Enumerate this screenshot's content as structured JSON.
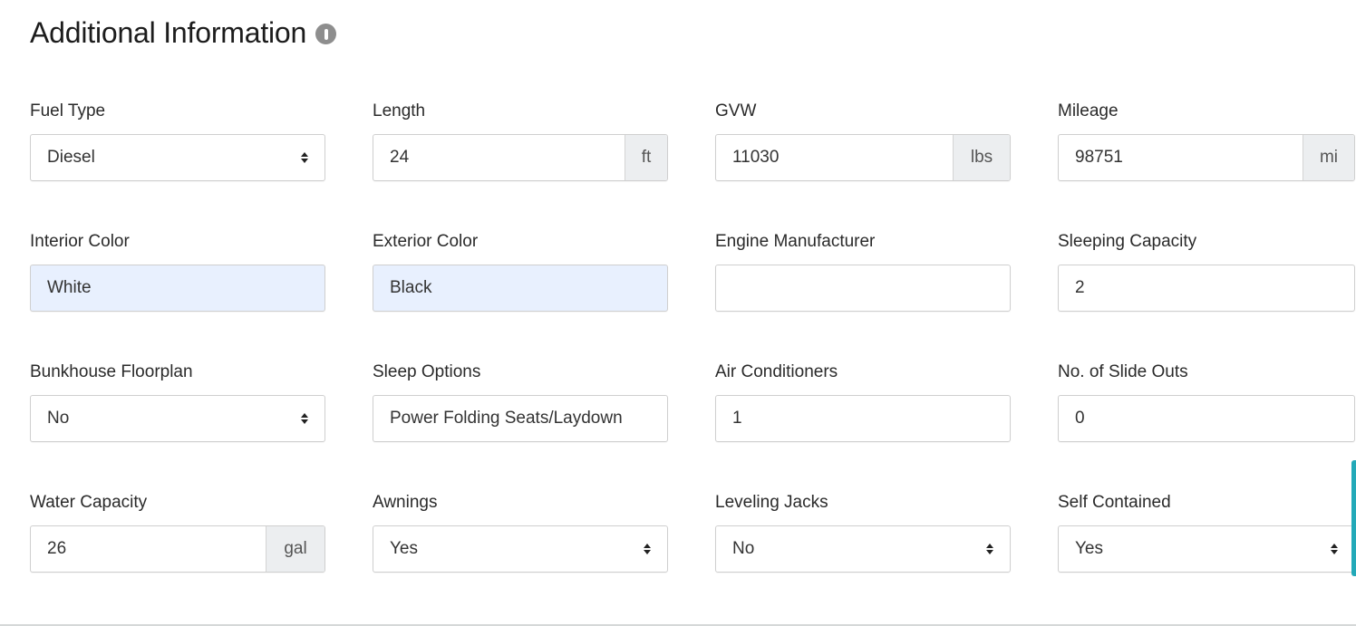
{
  "section": {
    "title": "Additional Information",
    "info_icon": "info-icon"
  },
  "fields": {
    "fuel_type": {
      "label": "Fuel Type",
      "value": "Diesel",
      "type": "select"
    },
    "length": {
      "label": "Length",
      "value": "24",
      "unit": "ft",
      "type": "input-addon"
    },
    "gvw": {
      "label": "GVW",
      "value": "11030",
      "unit": "lbs",
      "type": "input-addon"
    },
    "mileage": {
      "label": "Mileage",
      "value": "98751",
      "unit": "mi",
      "type": "input-addon"
    },
    "interior_color": {
      "label": "Interior Color",
      "value": "White",
      "type": "input",
      "autofilled": true
    },
    "exterior_color": {
      "label": "Exterior Color",
      "value": "Black",
      "type": "input",
      "autofilled": true
    },
    "engine_manufacturer": {
      "label": "Engine Manufacturer",
      "value": "",
      "type": "input"
    },
    "sleeping_capacity": {
      "label": "Sleeping Capacity",
      "value": "2",
      "type": "input"
    },
    "bunkhouse_floorplan": {
      "label": "Bunkhouse Floorplan",
      "value": "No",
      "type": "select"
    },
    "sleep_options": {
      "label": "Sleep Options",
      "value": "Power Folding Seats/Laydown",
      "type": "input"
    },
    "air_conditioners": {
      "label": "Air Conditioners",
      "value": "1",
      "type": "input"
    },
    "slide_outs": {
      "label": "No. of Slide Outs",
      "value": "0",
      "type": "input"
    },
    "water_capacity": {
      "label": "Water Capacity",
      "value": "26",
      "unit": "gal",
      "type": "input-addon"
    },
    "awnings": {
      "label": "Awnings",
      "value": "Yes",
      "type": "select"
    },
    "leveling_jacks": {
      "label": "Leveling Jacks",
      "value": "No",
      "type": "select"
    },
    "self_contained": {
      "label": "Self Contained",
      "value": "Yes",
      "type": "select"
    }
  },
  "colors": {
    "autofill_bg": "#e8f0fe",
    "addon_bg": "#eceef0",
    "scroll_accent": "#23a9b8"
  }
}
